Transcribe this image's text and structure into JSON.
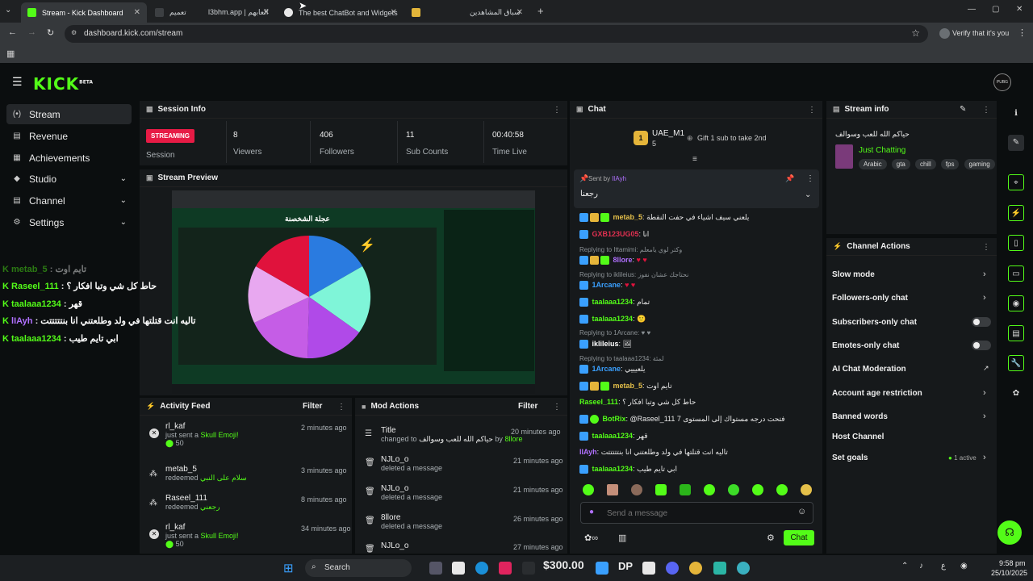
{
  "browser": {
    "tabs": [
      {
        "title": "Stream - Kick Dashboard",
        "color": "#53fc18"
      },
      {
        "title": "تعميم",
        "color": "#4a4a4a"
      },
      {
        "title": "l3bhm.app | العابهم",
        "color": "#4a4a4a"
      },
      {
        "title": "The best ChatBot and Widgets",
        "color": "#dddddd"
      },
      {
        "title": "",
        "color": "#e2b53a"
      },
      {
        "title": "سباق المشاهدين",
        "color": "#4a4a4a"
      }
    ],
    "url": "dashboard.kick.com/stream",
    "profile_label": "Verify that it's you",
    "new_tab": "+"
  },
  "brand": {
    "name": "KICK",
    "beta": "BETA",
    "accent": "#53fc18",
    "avatar": "PUBG"
  },
  "sidebar": {
    "items": [
      {
        "label": "Stream",
        "icon": "(•)"
      },
      {
        "label": "Revenue",
        "icon": "▤"
      },
      {
        "label": "Achievements",
        "icon": "▦"
      },
      {
        "label": "Studio",
        "icon": "◆"
      },
      {
        "label": "Channel",
        "icon": "▤"
      },
      {
        "label": "Settings",
        "icon": "⚙"
      }
    ]
  },
  "session": {
    "title": "Session Info",
    "status": "STREAMING",
    "status_label": "Session",
    "stats": [
      {
        "value": "8",
        "label": "Viewers"
      },
      {
        "value": "406",
        "label": "Followers"
      },
      {
        "value": "11",
        "label": "Sub Counts"
      },
      {
        "value": "00:40:58",
        "label": "Time Live"
      }
    ]
  },
  "preview": {
    "title": "Stream Preview",
    "wheel_title": "عجلة الشخصنة"
  },
  "activity": {
    "title": "Activity Feed",
    "filter": "Filter",
    "rows": [
      {
        "user": "rl_kaf",
        "action": "just sent a",
        "item": "Skull Emoji!",
        "time": "2 minutes ago",
        "amount": "50"
      },
      {
        "user": "metab_5",
        "action": "redeemed",
        "item": "سلام على النبي",
        "time": "3 minutes ago"
      },
      {
        "user": "Raseel_111",
        "action": "redeemed",
        "item": "رجعني",
        "time": "8 minutes ago"
      },
      {
        "user": "rl_kaf",
        "action": "just sent a",
        "item": "Skull Emoji!",
        "time": "34 minutes ago",
        "amount": "50"
      }
    ]
  },
  "mod": {
    "title": "Mod Actions",
    "filter": "Filter",
    "rows": [
      {
        "user": "Title",
        "action": "changed to",
        "item": "حياكم الله للعب وسوالف",
        "by": "by",
        "actor": "8llore",
        "time": "20 minutes ago"
      },
      {
        "user": "NJLo_o",
        "action": "deleted a message",
        "time": "21 minutes ago"
      },
      {
        "user": "NJLo_o",
        "action": "deleted a message",
        "time": "21 minutes ago"
      },
      {
        "user": "8llore",
        "action": "deleted a message",
        "time": "26 minutes ago"
      },
      {
        "user": "NJLo_o",
        "action": "",
        "time": "27 minutes ago"
      }
    ]
  },
  "chat": {
    "title": "Chat",
    "gifter": {
      "name": "UAE_M1",
      "rank": "1",
      "count": "5",
      "gift_text": "Gift 1 sub to take 2nd"
    },
    "pinned": {
      "sent_by": "Sent by",
      "user": "lIAyh",
      "message": "رجعنا"
    },
    "lines": [
      {
        "user": "metab_5",
        "color": "#e5c04a",
        "text": "يلعني سيف اشياء في حفت النقطة"
      },
      {
        "user": "GXB123UG05",
        "color": "#e03050",
        "text": "انا"
      },
      {
        "reply": "Replying to Ittamimi: وكتر لوي يامعلم"
      },
      {
        "user": "8llore",
        "color": "#b070ff",
        "text": "♥  ♥"
      },
      {
        "reply": "Replying to iklileius: نحتاجك عشان نفوز"
      },
      {
        "user": "1Arcane",
        "color": "#3aa0ff",
        "text": "♥  ♥"
      },
      {
        "user": "taalaaa1234",
        "color": "#53fc18",
        "text": "تمام"
      },
      {
        "user": "taalaaa1234",
        "color": "#53fc18",
        "text": "🙂"
      },
      {
        "reply": "Replying to 1Arcane: ♥ ♥"
      },
      {
        "user": "iklileius",
        "color": "#ffffff",
        "text": "🖼"
      },
      {
        "reply": "Replying to taalaaa1234: لمئة"
      },
      {
        "user": "1Arcane",
        "color": "#3aa0ff",
        "text": "يلعيييي"
      },
      {
        "user": "metab_5",
        "color": "#e5c04a",
        "text": "تايم اوت"
      },
      {
        "user": "Raseel_111",
        "color": "#53fc18",
        "text": "حاط كل شي وتبا افكار ؟"
      },
      {
        "user": "BotRix",
        "color": "#53fc18",
        "text": "@Raseel_111 فتحت درجه مستواك إلى المستوى 7"
      },
      {
        "user": "taalaaa1234",
        "color": "#53fc18",
        "text": "قهر"
      },
      {
        "user": "lIAyh",
        "color": "#b070ff",
        "text": "تاليه انت قتلتها في ولد وطلعتني انا بنتتتتتت"
      },
      {
        "user": "taalaaa1234",
        "color": "#53fc18",
        "text": "ابي تايم طيب"
      }
    ],
    "input_placeholder": "Send a message",
    "send": "Chat"
  },
  "stream_info": {
    "title": "Stream info",
    "stream_title": "حياكم الله للعب وسوالف",
    "category": "Just Chatting",
    "tags": [
      "Arabic",
      "gta",
      "chill",
      "fps",
      "gaming"
    ]
  },
  "channel_actions": {
    "title": "Channel Actions",
    "items": [
      {
        "label": "Slow mode",
        "type": "arrow"
      },
      {
        "label": "Followers-only chat",
        "type": "arrow"
      },
      {
        "label": "Subscribers-only chat",
        "type": "toggle"
      },
      {
        "label": "Emotes-only chat",
        "type": "toggle"
      },
      {
        "label": "AI Chat Moderation",
        "type": "external"
      },
      {
        "label": "Account age restriction",
        "type": "arrow"
      },
      {
        "label": "Banned words",
        "type": "arrow"
      },
      {
        "label": "Host Channel",
        "type": "none"
      },
      {
        "label": "Set goals",
        "type": "arrow",
        "meta": "1 active"
      }
    ]
  },
  "overlay_chat": [
    {
      "user": "metab_5",
      "text": "تايم اوت",
      "color": "#53fc18"
    },
    {
      "user": "Raseel_111",
      "text": "حاط كل شي وتبا افكار ؟",
      "color": "#53fc18"
    },
    {
      "user": "taalaaa1234",
      "text": "قهر",
      "color": "#53fc18"
    },
    {
      "user": "lIAyh",
      "text": "تاليه انت قتلتها في ولد وطلعتني انا بنتتتتتت",
      "color": "#b070ff"
    },
    {
      "user": "taalaaa1234",
      "text": "ابي تايم طيب",
      "color": "#53fc18"
    }
  ],
  "taskbar": {
    "search": "Search",
    "money": "$300.00",
    "time": "9:58 pm",
    "date": "25/10/2025",
    "lang": "ع"
  }
}
